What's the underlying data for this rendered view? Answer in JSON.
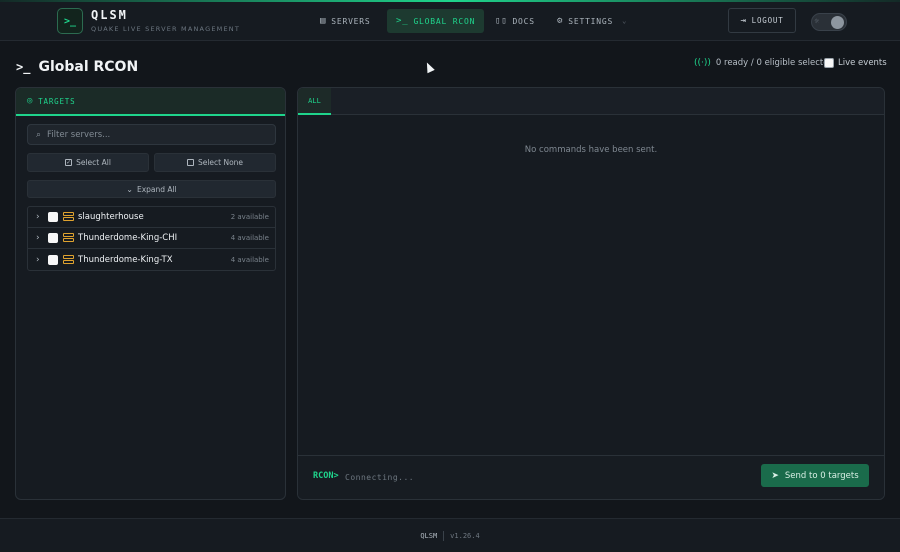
{
  "app": {
    "name": "QLSM",
    "subtitle": "QUAKE LIVE SERVER MANAGEMENT",
    "logo_glyph": ">_"
  },
  "nav": {
    "items": [
      {
        "label": "SERVERS",
        "icon": "server-icon"
      },
      {
        "label": "GLOBAL RCON",
        "icon": "terminal-icon"
      },
      {
        "label": "DOCS",
        "icon": "book-icon"
      },
      {
        "label": "SETTINGS",
        "icon": "gear-icon"
      }
    ],
    "active": "GLOBAL RCON",
    "logout_label": "LOGOUT"
  },
  "page": {
    "title": "Global RCON",
    "status": "0 ready / 0 eligible selected",
    "live_events_label": "Live events"
  },
  "targets": {
    "header": "TARGETS",
    "search_placeholder": "Filter servers...",
    "select_all": "Select All",
    "select_none": "Select None",
    "expand_all": "Expand All",
    "servers": [
      {
        "name": "slaughterhouse",
        "available": "2 available"
      },
      {
        "name": "Thunderdome-King-CHI",
        "available": "4 available"
      },
      {
        "name": "Thunderdome-King-TX",
        "available": "4 available"
      }
    ]
  },
  "console": {
    "tab_label": "ALL",
    "empty_message": "No commands have been sent.",
    "prompt": "RCON>",
    "input_placeholder": "Connecting...",
    "send_label": "Send to 0 targets"
  },
  "footer": {
    "name": "QLSM",
    "version": "v1.26.4"
  },
  "colors": {
    "accent": "#1fd48c",
    "server_icon": "#e0a32f",
    "background": "#12161b"
  }
}
